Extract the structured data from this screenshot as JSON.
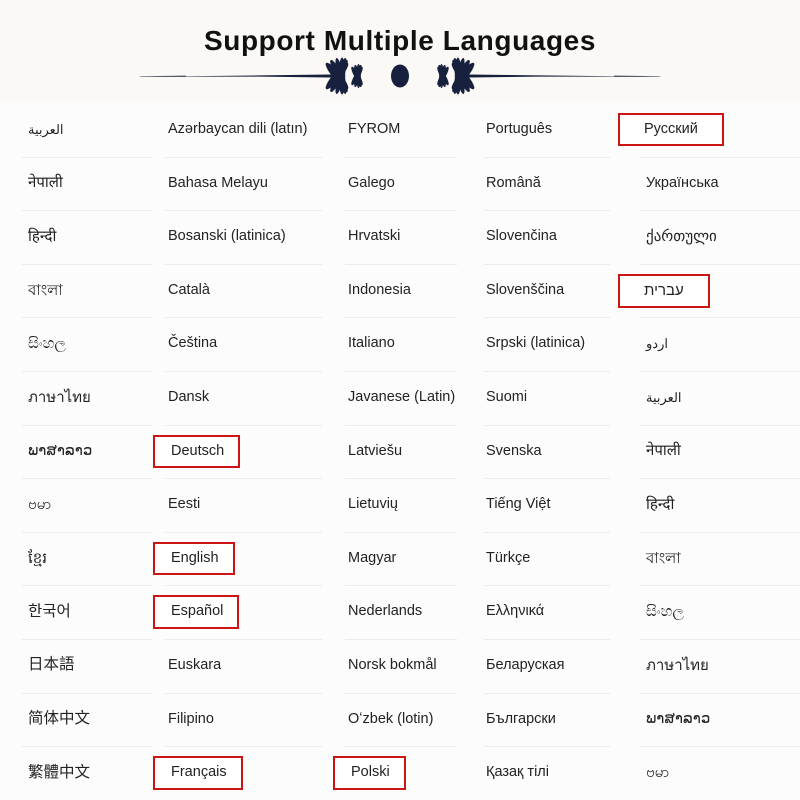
{
  "header": {
    "title": "Support Multiple Languages",
    "ornament_color": "#17203c",
    "background": "#faf9f5"
  },
  "style": {
    "highlight_color": "#cc1414",
    "divider_color": "#ececec",
    "text_color": "#222222",
    "page_background": "#fcfcfc"
  },
  "columns": [
    {
      "index": 1,
      "items": [
        {
          "label": "العربية",
          "script": "sc-ar",
          "highlighted": false
        },
        {
          "label": "नेपाली",
          "script": "sc-ind",
          "highlighted": false
        },
        {
          "label": "हिन्दी",
          "script": "sc-ind",
          "highlighted": false
        },
        {
          "label": "বাংলা",
          "script": "sc-ind",
          "highlighted": false
        },
        {
          "label": "සිංහල",
          "script": "sc-ind",
          "highlighted": false
        },
        {
          "label": "ภาษาไทย",
          "script": "sc-ind",
          "highlighted": false
        },
        {
          "label": "ພາສາລາວ",
          "script": "sc-ind",
          "highlighted": false
        },
        {
          "label": "ဗမာ",
          "script": "sc-ind",
          "highlighted": false
        },
        {
          "label": "ខ្មែរ",
          "script": "sc-ind",
          "highlighted": false
        },
        {
          "label": "한국어",
          "script": "sc-cjk",
          "highlighted": false
        },
        {
          "label": "日本語",
          "script": "sc-cjk",
          "highlighted": false
        },
        {
          "label": "简体中文",
          "script": "sc-cjk",
          "highlighted": false
        },
        {
          "label": "繁體中文",
          "script": "sc-cjk",
          "highlighted": false
        }
      ]
    },
    {
      "index": 2,
      "items": [
        {
          "label": "Azərbaycan dili (latın)",
          "script": "",
          "highlighted": false
        },
        {
          "label": "Bahasa Melayu",
          "script": "",
          "highlighted": false
        },
        {
          "label": "Bosanski (latinica)",
          "script": "",
          "highlighted": false
        },
        {
          "label": "Català",
          "script": "",
          "highlighted": false
        },
        {
          "label": "Čeština",
          "script": "",
          "highlighted": false
        },
        {
          "label": "Dansk",
          "script": "",
          "highlighted": false
        },
        {
          "label": "Deutsch",
          "script": "",
          "highlighted": true
        },
        {
          "label": "Eesti",
          "script": "",
          "highlighted": false
        },
        {
          "label": "English",
          "script": "",
          "highlighted": true
        },
        {
          "label": "Español",
          "script": "",
          "highlighted": true
        },
        {
          "label": "Euskara",
          "script": "",
          "highlighted": false
        },
        {
          "label": "Filipino",
          "script": "",
          "highlighted": false
        },
        {
          "label": "Français",
          "script": "",
          "highlighted": true
        }
      ]
    },
    {
      "index": 3,
      "items": [
        {
          "label": "FYROM",
          "script": "",
          "highlighted": false
        },
        {
          "label": "Galego",
          "script": "",
          "highlighted": false
        },
        {
          "label": "Hrvatski",
          "script": "",
          "highlighted": false
        },
        {
          "label": "Indonesia",
          "script": "",
          "highlighted": false
        },
        {
          "label": "Italiano",
          "script": "",
          "highlighted": false
        },
        {
          "label": "Javanese (Latin)",
          "script": "",
          "highlighted": false
        },
        {
          "label": "Latviešu",
          "script": "",
          "highlighted": false
        },
        {
          "label": "Lietuvių",
          "script": "",
          "highlighted": false
        },
        {
          "label": "Magyar",
          "script": "",
          "highlighted": false
        },
        {
          "label": "Nederlands",
          "script": "",
          "highlighted": false
        },
        {
          "label": "Norsk bokmål",
          "script": "",
          "highlighted": false
        },
        {
          "label": "Oʻzbek (lotin)",
          "script": "",
          "highlighted": false
        },
        {
          "label": "Polski",
          "script": "",
          "highlighted": true
        }
      ]
    },
    {
      "index": 4,
      "items": [
        {
          "label": "Português",
          "script": "",
          "highlighted": false
        },
        {
          "label": "Română",
          "script": "",
          "highlighted": false
        },
        {
          "label": "Slovenčina",
          "script": "",
          "highlighted": false
        },
        {
          "label": "Slovenščina",
          "script": "",
          "highlighted": false
        },
        {
          "label": "Srpski (latinica)",
          "script": "",
          "highlighted": false
        },
        {
          "label": "Suomi",
          "script": "",
          "highlighted": false
        },
        {
          "label": "Svenska",
          "script": "",
          "highlighted": false
        },
        {
          "label": "Tiếng Việt",
          "script": "",
          "highlighted": false
        },
        {
          "label": "Türkçe",
          "script": "",
          "highlighted": false
        },
        {
          "label": "Ελληνικά",
          "script": "",
          "highlighted": false
        },
        {
          "label": "Беларуская",
          "script": "",
          "highlighted": false
        },
        {
          "label": "Български",
          "script": "",
          "highlighted": false
        },
        {
          "label": "Қазақ тілі",
          "script": "",
          "highlighted": false
        }
      ]
    },
    {
      "index": 5,
      "items": [
        {
          "label": "Русский",
          "script": "",
          "highlighted": true
        },
        {
          "label": "Українська",
          "script": "",
          "highlighted": false
        },
        {
          "label": "ქართული",
          "script": "sc-ka",
          "highlighted": false
        },
        {
          "label": "עברית",
          "script": "sc-he",
          "highlighted": true
        },
        {
          "label": "اردو",
          "script": "sc-ar",
          "highlighted": false
        },
        {
          "label": "العربية",
          "script": "sc-ar",
          "highlighted": false
        },
        {
          "label": "नेपाली",
          "script": "sc-ind",
          "highlighted": false
        },
        {
          "label": "हिन्दी",
          "script": "sc-ind",
          "highlighted": false
        },
        {
          "label": "বাংলা",
          "script": "sc-ind",
          "highlighted": false
        },
        {
          "label": "සිංහල",
          "script": "sc-ind",
          "highlighted": false
        },
        {
          "label": "ภาษาไทย",
          "script": "sc-ind",
          "highlighted": false
        },
        {
          "label": "ພາສາລາວ",
          "script": "sc-ind",
          "highlighted": false
        },
        {
          "label": "ဗမာ",
          "script": "sc-ind",
          "highlighted": false
        }
      ]
    }
  ]
}
